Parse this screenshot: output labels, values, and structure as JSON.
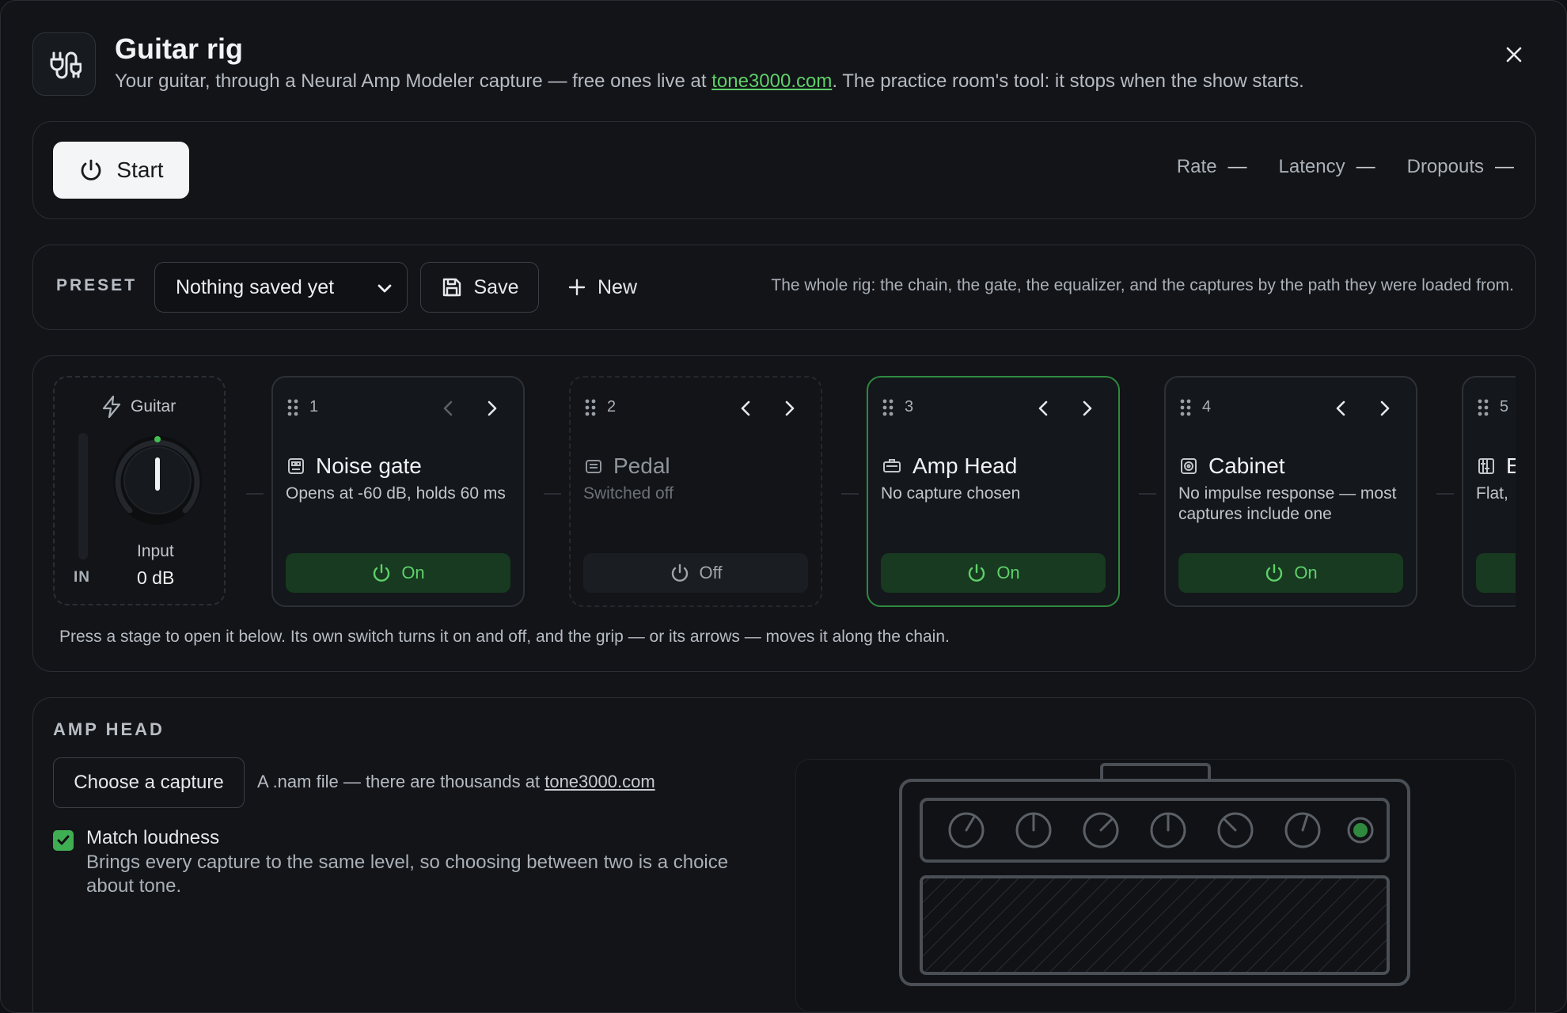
{
  "header": {
    "title": "Guitar rig",
    "subtitle_before": "Your guitar, through a Neural Amp Modeler capture — free ones live at ",
    "subtitle_link": "tone3000.com",
    "subtitle_after": ". The practice room's tool: it stops when the show starts."
  },
  "transport": {
    "start_label": "Start",
    "stats": [
      {
        "label": "Rate",
        "value": "—"
      },
      {
        "label": "Latency",
        "value": "—"
      },
      {
        "label": "Dropouts",
        "value": "—"
      }
    ]
  },
  "preset": {
    "label": "PRESET",
    "selected": "Nothing saved yet",
    "save_label": "Save",
    "new_label": "New",
    "description": "The whole rig: the chain, the gate, the equalizer, and the captures by the path they were loaded from."
  },
  "input": {
    "source": "Guitar",
    "meter_label": "IN",
    "knob_label": "Input",
    "knob_value": "0 dB"
  },
  "stages": [
    {
      "num": "1",
      "name": "Noise gate",
      "desc": "Opens at -60 dB, holds 60 ms",
      "state": "On",
      "icon": "noise-gate-icon"
    },
    {
      "num": "2",
      "name": "Pedal",
      "desc": "Switched off",
      "state": "Off",
      "icon": "pedal-icon"
    },
    {
      "num": "3",
      "name": "Amp Head",
      "desc": "No capture chosen",
      "state": "On",
      "icon": "amp-head-icon"
    },
    {
      "num": "4",
      "name": "Cabinet",
      "desc": "No impulse response — most captures include one",
      "state": "On",
      "icon": "cabinet-icon"
    },
    {
      "num": "5",
      "name": "E",
      "desc": "Flat, ",
      "state": "",
      "icon": "equalizer-icon"
    }
  ],
  "chain_help": "Press a stage to open it below. Its own switch turns it on and off, and the grip — or its arrows — moves it along the chain.",
  "amp_head": {
    "title": "AMP HEAD",
    "choose_label": "Choose a capture",
    "note_before": "A .nam file — there are thousands at ",
    "note_link": "tone3000.com",
    "match_loudness": true,
    "match_label": "Match loudness",
    "match_desc": "Brings every capture to the same level, so choosing between two is a choice about tone."
  },
  "colors": {
    "accent": "#5fd06a",
    "on_bg": "#173a20",
    "selected_border": "#2f8a3f",
    "background": "#121418"
  }
}
